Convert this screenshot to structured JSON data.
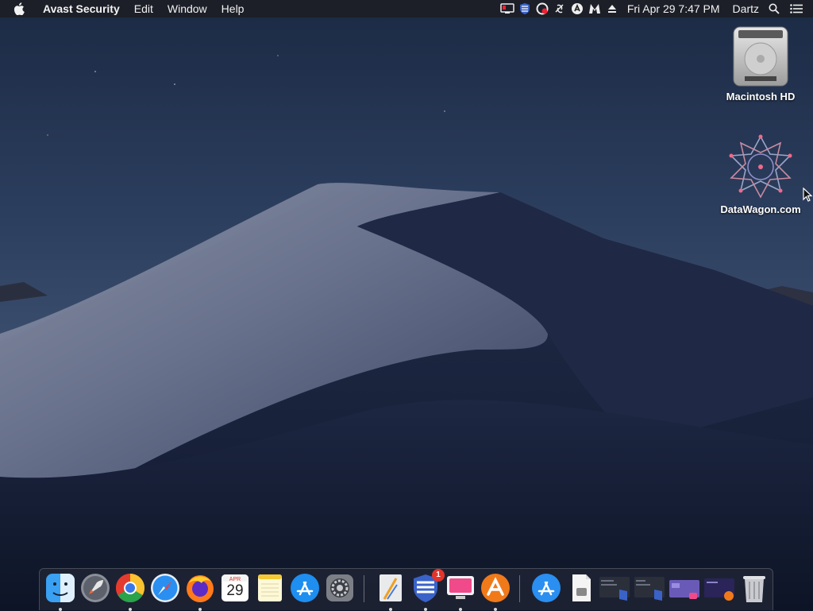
{
  "menubar": {
    "app_name": "Avast Security",
    "menus": [
      "Edit",
      "Window",
      "Help"
    ],
    "datetime": "Fri Apr 29  7:47 PM",
    "user": "Dartz",
    "status_icons": [
      "display-icon",
      "shield-icon",
      "avast-icon",
      "link-icon",
      "stop-icon",
      "malwarebytes-icon",
      "eject-icon",
      "search-icon",
      "notification-list-icon"
    ]
  },
  "desktop": {
    "icons": [
      {
        "label": "Macintosh HD",
        "icon": "hard-drive-icon"
      },
      {
        "label": "DataWagon.com",
        "icon": "network-star-icon"
      }
    ]
  },
  "dock": {
    "items": [
      {
        "name": "finder",
        "icon": "finder-icon",
        "running": true
      },
      {
        "name": "launchpad",
        "icon": "rocket-icon",
        "running": false
      },
      {
        "name": "chrome",
        "icon": "chrome-icon",
        "running": true
      },
      {
        "name": "safari",
        "icon": "compass-icon",
        "running": false
      },
      {
        "name": "firefox",
        "icon": "firefox-icon",
        "running": true
      },
      {
        "name": "calendar",
        "icon": "calendar-icon",
        "running": false,
        "month": "APR",
        "day": "29"
      },
      {
        "name": "notes",
        "icon": "notes-icon",
        "running": false
      },
      {
        "name": "app-store",
        "icon": "app-store-icon",
        "running": false
      },
      {
        "name": "system-preferences",
        "icon": "gear-icon",
        "running": false
      },
      {
        "name": "xcode-instruments",
        "icon": "drawing-icon",
        "running": true
      },
      {
        "name": "secure-app",
        "icon": "shield-icon",
        "running": true,
        "badge": "1"
      },
      {
        "name": "cleanmymac",
        "icon": "monitor-icon",
        "running": true
      },
      {
        "name": "avast",
        "icon": "avast-icon",
        "running": true
      },
      {
        "name": "downloads-store",
        "icon": "app-store-icon",
        "running": false
      },
      {
        "name": "document",
        "icon": "document-icon",
        "running": false
      },
      {
        "name": "window-thumb-1",
        "icon": "window-thumbnail-icon",
        "running": false
      },
      {
        "name": "window-thumb-2",
        "icon": "window-thumbnail-icon",
        "running": false
      },
      {
        "name": "window-thumb-3",
        "icon": "window-thumbnail-icon",
        "running": false
      },
      {
        "name": "window-thumb-4",
        "icon": "window-thumbnail-icon",
        "running": false
      },
      {
        "name": "trash",
        "icon": "trash-icon",
        "running": false
      }
    ]
  }
}
